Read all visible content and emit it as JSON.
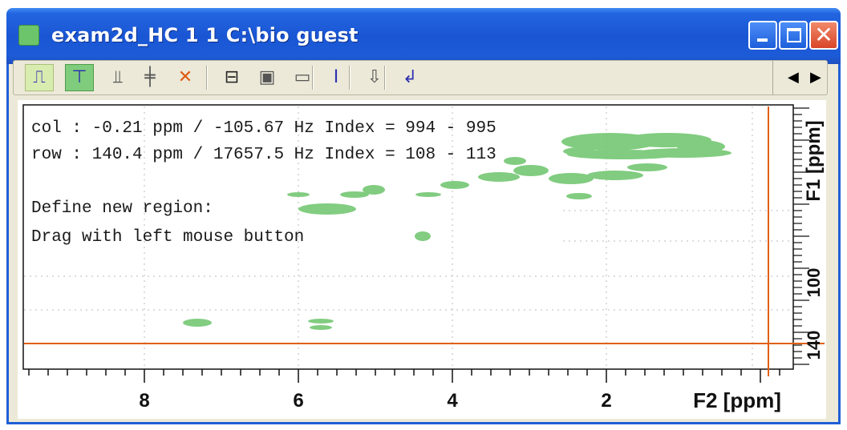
{
  "window": {
    "title": "exam2d_HC  1  1  C:\\bio  guest"
  },
  "toolbar": {
    "buttons": [
      {
        "name": "trace-icon",
        "glyph": "⎍",
        "color": "#2a2ab0"
      },
      {
        "name": "row-cursor-icon",
        "glyph": "⊤",
        "color": "#2a2ab0"
      },
      {
        "name": "column-cursor-icon",
        "glyph": "⫫",
        "color": "#555555"
      },
      {
        "name": "cross-cursor-icon",
        "glyph": "╪",
        "color": "#555555"
      },
      {
        "name": "cancel-cursor-icon",
        "glyph": "✕",
        "color": "#e05a10"
      },
      {
        "name": "projection-icon",
        "glyph": "⊟",
        "color": "#222222"
      },
      {
        "name": "save-region-icon",
        "glyph": "▣",
        "color": "#555555"
      },
      {
        "name": "frame-icon",
        "glyph": "▭",
        "color": "#555555"
      },
      {
        "name": "scale-icon",
        "glyph": "I",
        "color": "#3030b0"
      },
      {
        "name": "export-icon",
        "glyph": "⇩",
        "color": "#555555"
      },
      {
        "name": "return-icon",
        "glyph": "↲",
        "color": "#3030b0"
      }
    ],
    "nav_left": "◀",
    "nav_right": "▶"
  },
  "plot": {
    "info_lines": [
      "col : -0.21 ppm / -105.67 Hz Index = 994 - 995",
      "row : 140.4 ppm / 17657.5 Hz Index = 108 - 113",
      "",
      "Define new region:",
      "Drag with left mouse button"
    ],
    "x_axis": {
      "label": "F2 [ppm]",
      "tick_labels": [
        "8",
        "6",
        "4",
        "2"
      ]
    },
    "y_axis": {
      "label": "F1 [ppm]",
      "tick_labels": [
        "100",
        "140"
      ]
    },
    "cursor_color": "#e06010",
    "peak_color": "#6cc46b"
  }
}
